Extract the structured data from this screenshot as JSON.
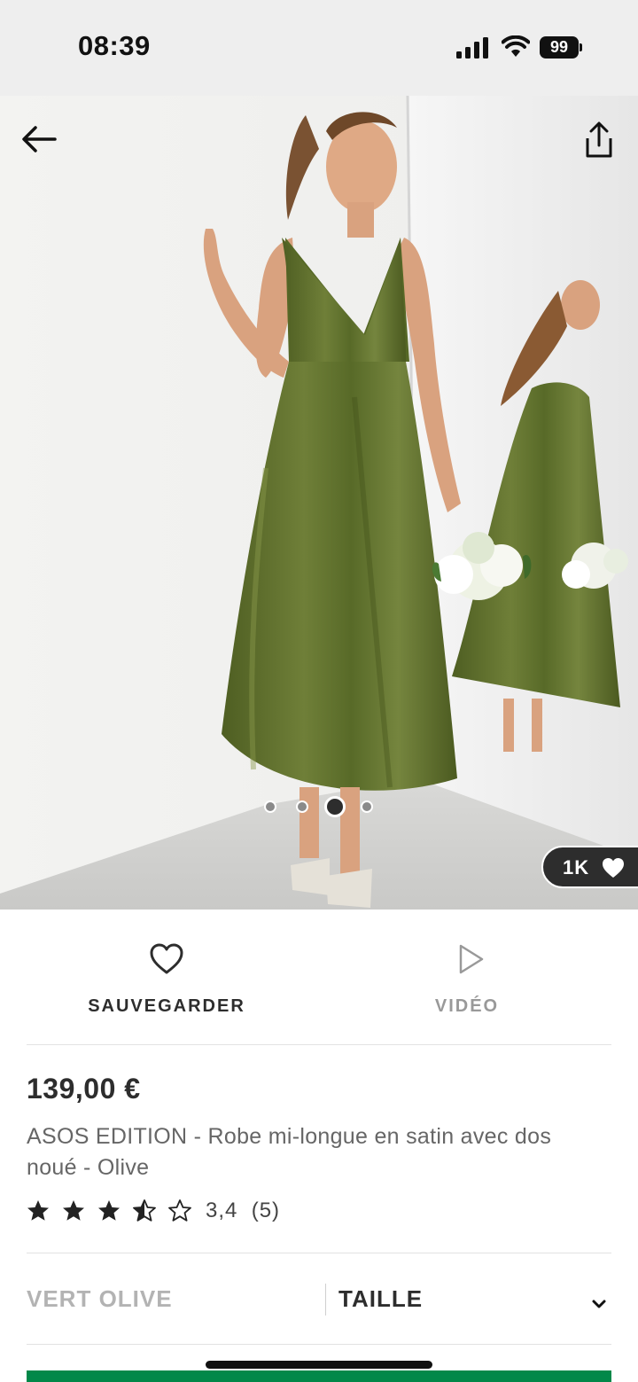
{
  "status_bar": {
    "time": "08:39",
    "battery": "99",
    "icons": [
      "signal-icon",
      "wifi-icon",
      "battery-icon"
    ]
  },
  "gallery": {
    "image_description_name": "product-photo",
    "dot_count": 4,
    "active_dot": 3,
    "likes": "1K",
    "icons": [
      "back-arrow-icon",
      "share-icon",
      "heart-filled-icon"
    ]
  },
  "actions": {
    "save_label": "SAUVEGARDER",
    "video_label": "VIDÉO"
  },
  "product": {
    "price": "139,00 €",
    "title": "ASOS EDITION - Robe mi-longue en satin avec dos noué - Olive",
    "rating_value": "3,4",
    "rating_count": "(5)",
    "stars": 3.4
  },
  "selectors": {
    "colour": "VERT OLIVE",
    "size_label": "TAILLE"
  },
  "colors": {
    "accent_green": "#018849",
    "dress_olive": "#5e6e2e",
    "text_dark": "#2d2d2d",
    "text_muted": "#999999"
  }
}
